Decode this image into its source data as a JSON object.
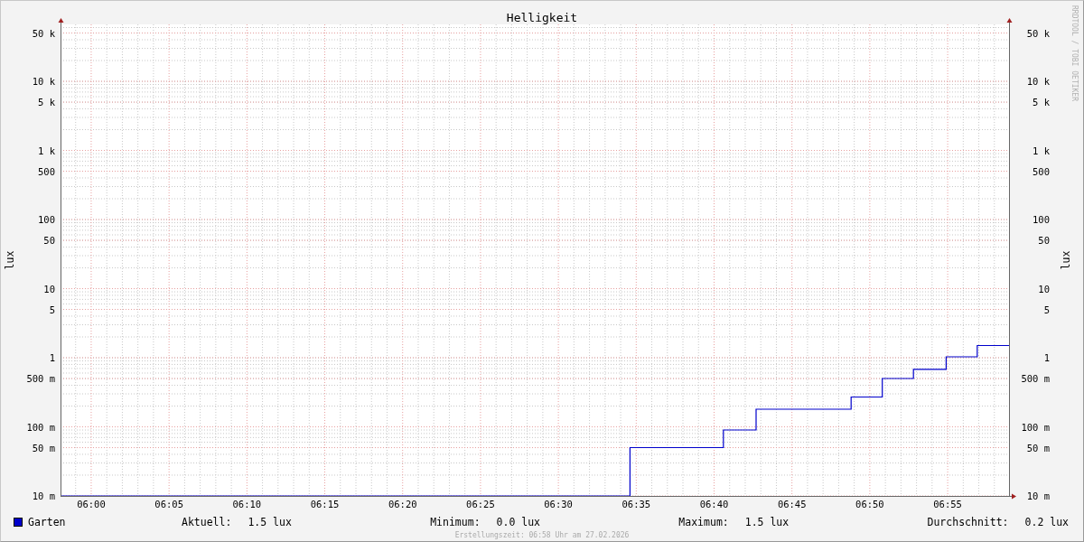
{
  "chart": {
    "title": "Helligkeit",
    "left_axis": {
      "label": "lux",
      "tick_labels": [
        "50 k",
        "10 k",
        "5 k",
        "1 k",
        "500",
        "100",
        "50",
        "10",
        "5",
        "1",
        "500 m",
        "100 m",
        "50 m",
        "10 m"
      ]
    },
    "right_axis": {
      "label": "lux",
      "tick_labels": [
        "50 k",
        "10 k",
        "5 k",
        "1 k",
        "500",
        "100",
        "50",
        "10",
        "5",
        "1",
        "500 m",
        "100 m",
        "50 m",
        "10 m"
      ]
    },
    "x_axis": {
      "tick_labels": [
        "06:00",
        "06:05",
        "06:10",
        "06:15",
        "06:20",
        "06:25",
        "06:30",
        "06:35",
        "06:40",
        "06:45",
        "06:50",
        "06:55"
      ]
    },
    "credit": "RRDTOOL / TOBI OETIKER"
  },
  "legend": {
    "series": {
      "name": "Garten",
      "color": "#0000cc"
    },
    "stats": [
      {
        "label": "Aktuell:",
        "value": "1.5 lux"
      },
      {
        "label": "Minimum:",
        "value": "0.0 lux"
      },
      {
        "label": "Maximum:",
        "value": "1.5 lux"
      },
      {
        "label": "Durchschnitt:",
        "value": "0.2 lux"
      }
    ]
  },
  "footer": "Erstellungszeit: 06:58 Uhr am 27.02.2026"
}
